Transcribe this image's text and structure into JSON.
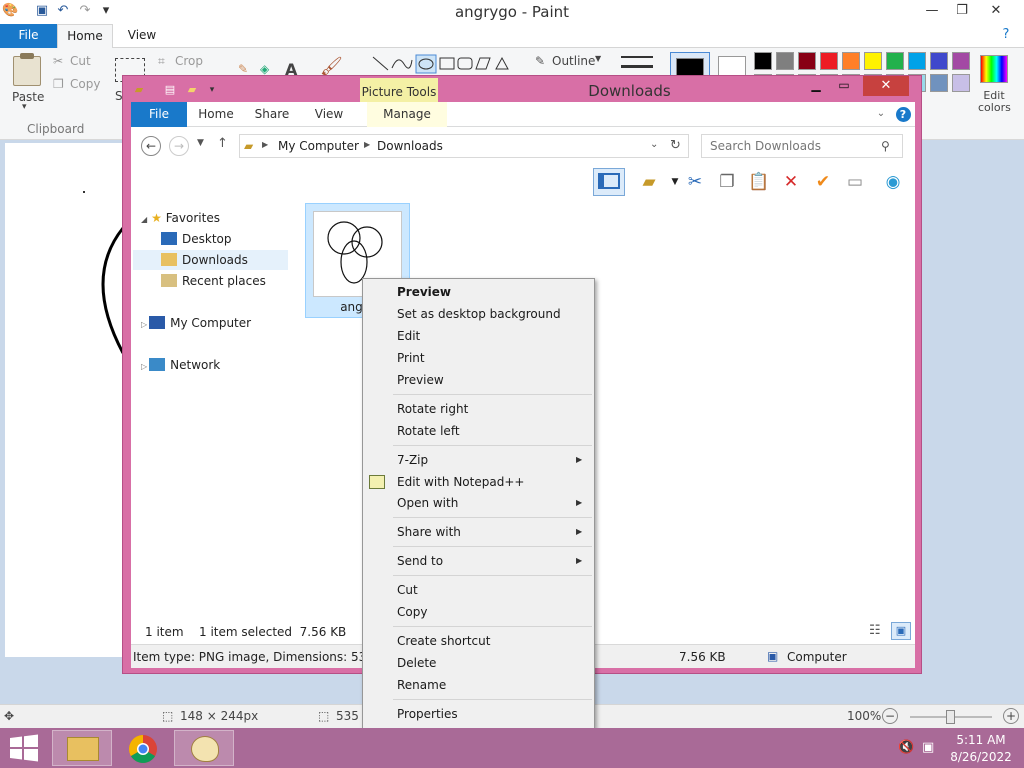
{
  "paint": {
    "title": "angrygo - Paint",
    "tabs": {
      "file": "File",
      "home": "Home",
      "view": "View"
    },
    "ribbon": {
      "paste": "Paste",
      "cut": "Cut",
      "copy": "Copy",
      "crop": "Crop",
      "clipboard_group": "Clipboard",
      "outline": "Outline",
      "edit_colors": "Edit colors",
      "s_letter": "S",
      "a_letter": "A"
    },
    "palette": [
      "#000000",
      "#7f7f7f",
      "#880015",
      "#ed1c24",
      "#ff7f27",
      "#fff200",
      "#22b14c",
      "#00a2e8",
      "#3f48cc",
      "#a349a4",
      "#ffffff",
      "#c3c3c3",
      "#b97a57",
      "#ffaec9",
      "#ffc90e",
      "#efe4b0",
      "#b5e61d",
      "#99d9ea",
      "#7092be",
      "#c8bfe7"
    ],
    "status": {
      "cursor_pos": "148 × 244px",
      "selection": "535 ×",
      "zoom": "100%"
    }
  },
  "explorer": {
    "title": "Downloads",
    "picture_tools": "Picture Tools",
    "tabs": {
      "file": "File",
      "home": "Home",
      "share": "Share",
      "view": "View",
      "manage": "Manage"
    },
    "address": {
      "root": "My Computer",
      "folder": "Downloads"
    },
    "search_placeholder": "Search Downloads",
    "nav": {
      "favorites": "Favorites",
      "desktop": "Desktop",
      "downloads": "Downloads",
      "recent": "Recent places",
      "my_computer": "My Computer",
      "network": "Network"
    },
    "file_name": "angry",
    "status": {
      "count": "1 item",
      "selected": "1 item selected  7.56 KB"
    },
    "details": {
      "item_type": "Item type: PNG image, Dimensions: 535 x 51",
      "size": "7.56 KB",
      "computer": "Computer"
    }
  },
  "context_menu": {
    "preview_bold": "Preview",
    "set_background": "Set as desktop background",
    "edit": "Edit",
    "print": "Print",
    "preview": "Preview",
    "rotate_right": "Rotate right",
    "rotate_left": "Rotate left",
    "seven_zip": "7-Zip",
    "edit_npp": "Edit with Notepad++",
    "open_with": "Open with",
    "share_with": "Share with",
    "send_to": "Send to",
    "cut": "Cut",
    "copy": "Copy",
    "create_shortcut": "Create shortcut",
    "delete": "Delete",
    "rename": "Rename",
    "properties": "Properties"
  },
  "taskbar": {
    "time": "5:11 AM",
    "date": "8/26/2022"
  },
  "colors": {
    "accent": "#1979ca",
    "explorer_frame": "#d86fa6",
    "taskbar": "#a96a97",
    "close": "#c7413f"
  }
}
